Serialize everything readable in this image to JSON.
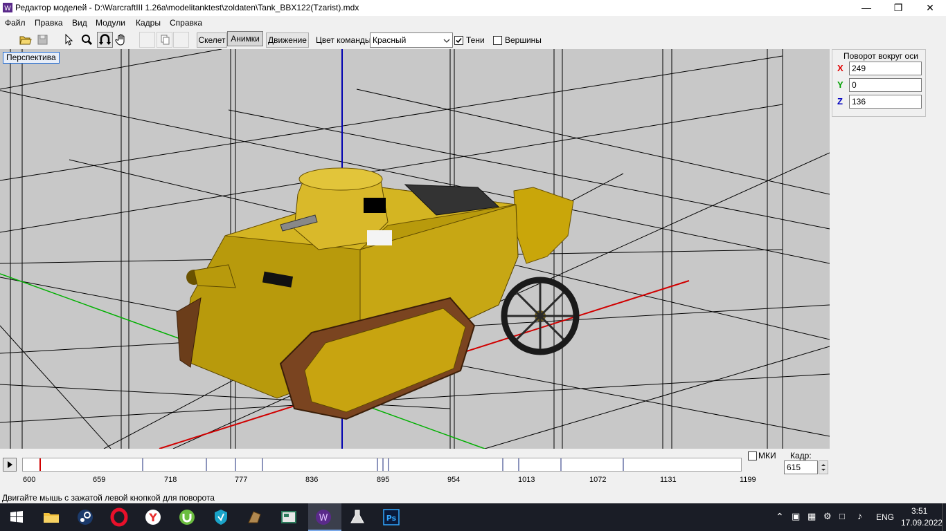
{
  "window": {
    "title": "Редактор моделей - D:\\WarcraftIII 1.26a\\modelitanktest\\zoldaten\\Tank_BBX122(Tzarist).mdx",
    "minimize_icon": "minimize-icon",
    "maximize_icon": "restore-icon",
    "close_icon": "close-icon"
  },
  "menu": {
    "items": [
      "Файл",
      "Правка",
      "Вид",
      "Модули",
      "Кадры",
      "Справка"
    ]
  },
  "toolbar": {
    "skeleton_label": "Скелет",
    "animations_label": "Анимки",
    "movement_label": "Движение",
    "team_color_label": "Цвет команды:",
    "team_color_value": "Красный",
    "shadows_label": "Тени",
    "shadows_checked": true,
    "vertices_label": "Вершины",
    "vertices_checked": false,
    "icons": [
      "open-icon",
      "save-icon",
      "select-arrow-icon",
      "zoom-icon",
      "rotate-icon",
      "pan-hand-icon",
      "blank-icon",
      "copy-icon",
      "blank-icon"
    ]
  },
  "viewport": {
    "mode_label": "Перспектива",
    "background": "#c8c8c8",
    "model": "tank-model"
  },
  "rotation_panel": {
    "title": "Поворот вокруг оси",
    "x_label": "X",
    "x_value": "249",
    "y_label": "Y",
    "y_value": "0",
    "z_label": "Z",
    "z_value": "136",
    "x_color": "#e00000",
    "y_color": "#00a000",
    "z_color": "#0000c0"
  },
  "timeline": {
    "play_icon": "play-icon",
    "ticks": [
      "600",
      "659",
      "718",
      "777",
      "836",
      "895",
      "954",
      "1013",
      "1072",
      "1131",
      "1199"
    ],
    "mki_label": "МКИ",
    "frame_label": "Кадр:",
    "frame_value": "615"
  },
  "status": {
    "text": "Двигайте мышь с зажатой левой кнопкой для поворота"
  },
  "taskbar": {
    "apps": [
      "windows-start-icon",
      "file-explorer-icon",
      "steam-icon",
      "opera-icon",
      "yandex-browser-icon",
      "utorrent-icon",
      "vpn-shield-icon",
      "warcraft-tool-icon",
      "document-viewer-icon",
      "model-editor-icon",
      "lab-flask-icon",
      "photoshop-icon"
    ],
    "language": "ENG",
    "time": "3:51",
    "date": "17.09.2022"
  }
}
